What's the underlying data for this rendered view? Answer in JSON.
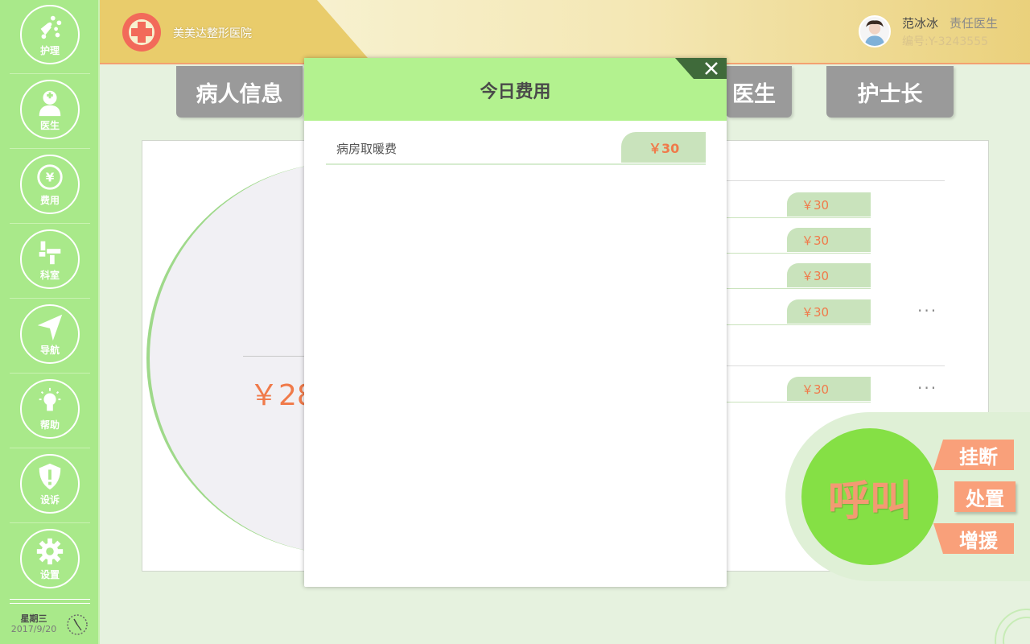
{
  "sidebar": {
    "items": [
      {
        "label": "护理",
        "icon": "nursing-icon"
      },
      {
        "label": "医生",
        "icon": "doctor-icon"
      },
      {
        "label": "费用",
        "icon": "yen-icon"
      },
      {
        "label": "科室",
        "icon": "department-icon"
      },
      {
        "label": "导航",
        "icon": "navigation-icon"
      },
      {
        "label": "帮助",
        "icon": "lightbulb-icon"
      },
      {
        "label": "设诉",
        "icon": "shield-icon"
      },
      {
        "label": "设置",
        "icon": "gear-icon"
      }
    ],
    "weekday": "星期三",
    "date": "2017/9/20"
  },
  "header": {
    "hospital_name": "美美达整形医院",
    "user_name": "范冰冰",
    "user_role": "责任医生",
    "user_id": "编号:Y-3243555"
  },
  "tabs": {
    "patient_info": "病人信息",
    "doctor": "医生",
    "head_nurse": "护士长"
  },
  "main": {
    "total": "￥28",
    "fees": [
      "￥30",
      "￥30",
      "￥30",
      "￥30",
      "￥30"
    ],
    "more_label": "···"
  },
  "call": {
    "call_label": "呼叫",
    "actions": [
      "挂断",
      "处置",
      "增援"
    ]
  },
  "modal": {
    "title": "今日费用",
    "rows": [
      {
        "label": "病房取暖费",
        "amount": "￥30"
      }
    ]
  },
  "colors": {
    "sidebar_bg": "#a9e98a",
    "header_gold": "#e9cc6b",
    "accent_orange": "#f07a4a",
    "modal_header": "#b3f28f",
    "call_green": "#85e045"
  }
}
